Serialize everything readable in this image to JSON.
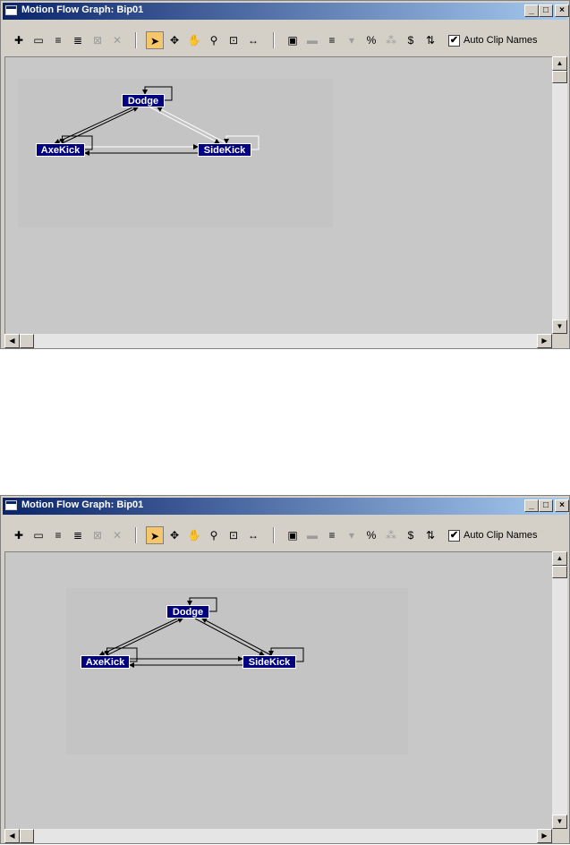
{
  "title": "Motion Flow Graph: Bip01",
  "window_controls": {
    "minimize": "_",
    "maximize": "□",
    "close": "×"
  },
  "toolbar": {
    "buttons": [
      {
        "icon": "create-clip-icon",
        "glyph": "✚"
      },
      {
        "icon": "open-folder-icon",
        "glyph": "▭"
      },
      {
        "icon": "script-icon",
        "glyph": "≡"
      },
      {
        "icon": "script-add-icon",
        "glyph": "≣"
      },
      {
        "icon": "delete-script-icon",
        "glyph": "⊠"
      },
      {
        "icon": "delete-icon",
        "glyph": "✕"
      },
      {
        "icon": "select-arrow-icon",
        "glyph": "➤"
      },
      {
        "icon": "move-icon",
        "glyph": "✥"
      },
      {
        "icon": "pan-hand-icon",
        "glyph": "✋"
      },
      {
        "icon": "zoom-icon",
        "glyph": "⚲"
      },
      {
        "icon": "zoom-region-icon",
        "glyph": "⊡"
      },
      {
        "icon": "zoom-extents-icon",
        "glyph": "↔"
      },
      {
        "icon": "clip-properties-icon",
        "glyph": "▣"
      },
      {
        "icon": "transition-icon",
        "glyph": "▬"
      },
      {
        "icon": "show-script-icon",
        "glyph": "≡"
      },
      {
        "icon": "random-transition-icon",
        "glyph": "▾"
      },
      {
        "icon": "percent-icon",
        "glyph": "%"
      },
      {
        "icon": "optimize-icon",
        "glyph": "⁂"
      },
      {
        "icon": "dollar-icon",
        "glyph": "$"
      },
      {
        "icon": "random-start-icon",
        "glyph": "⇅"
      }
    ],
    "auto_clip_names_label": "Auto Clip Names",
    "auto_clip_names_checked": "✔"
  },
  "scroll": {
    "up": "▲",
    "down": "▼",
    "left": "◀",
    "right": "▶"
  },
  "windows": [
    {
      "nodes": {
        "dodge": "Dodge",
        "axekick": "AxeKick",
        "sidekick": "SideKick"
      }
    },
    {
      "nodes": {
        "dodge": "Dodge",
        "axekick": "AxeKick",
        "sidekick": "SideKick"
      }
    }
  ]
}
